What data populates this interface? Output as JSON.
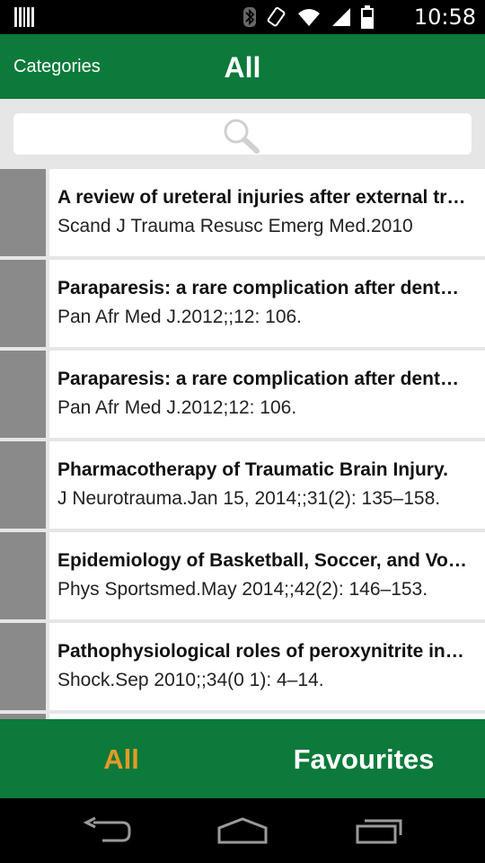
{
  "status_bar": {
    "time": "10:58",
    "icons": [
      "barcode-icon",
      "bluetooth-icon",
      "rotate-icon",
      "wifi-icon",
      "signal-icon",
      "battery-icon"
    ]
  },
  "header": {
    "categories_label": "Categories",
    "title": "All"
  },
  "search": {
    "placeholder": "",
    "value": "",
    "icon": "search-icon"
  },
  "articles": [
    {
      "title": "A review of ureteral injuries after external trauma.",
      "source": "Scand J Trauma Resusc Emerg Med.2010"
    },
    {
      "title": "Paraparesis: a rare complication after dental procedure.",
      "source": "Pan Afr Med J.2012;;12: 106."
    },
    {
      "title": "Paraparesis: a rare complication after dental procedure.",
      "source": "Pan Afr Med J.2012;12: 106."
    },
    {
      "title": "Pharmacotherapy of Traumatic Brain Injury.",
      "source": "J Neurotrauma.Jan 15, 2014;;31(2): 135–158."
    },
    {
      "title": "Epidemiology of Basketball, Soccer, and Volleyball Injuries.",
      "source": "Phys Sportsmed.May 2014;;42(2): 146–153."
    },
    {
      "title": "Pathophysiological roles of peroxynitrite in circulatory shock.",
      "source": "Shock.Sep 2010;;34(0 1): 4–14."
    }
  ],
  "bottom_tabs": {
    "all_label": "All",
    "favourites_label": "Favourites",
    "active": "All"
  },
  "colors": {
    "brand_green": "#0b7a3b",
    "active_tab": "#e69a26",
    "thumbnail_gray": "#8a8a8a",
    "background_gray": "#e6e6e6"
  },
  "nav_bar": {
    "icons": [
      "back-icon",
      "home-icon",
      "recent-apps-icon"
    ]
  }
}
